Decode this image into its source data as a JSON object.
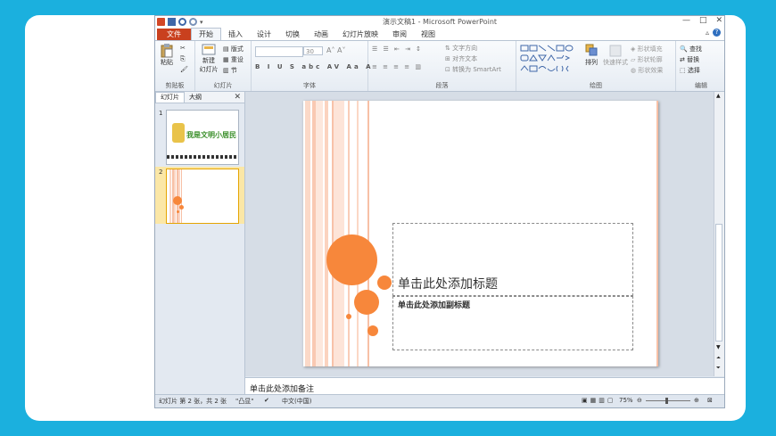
{
  "window": {
    "title": "演示文稿1 - Microsoft PowerPoint",
    "controls": [
      "—",
      "□",
      "✕"
    ]
  },
  "tabs": {
    "file": "文件",
    "items": [
      "开始",
      "插入",
      "设计",
      "切换",
      "动画",
      "幻灯片放映",
      "审阅",
      "视图"
    ],
    "active": "开始"
  },
  "ribbon": {
    "clipboard": {
      "label": "剪贴板",
      "paste": "粘贴"
    },
    "slides": {
      "label": "幻灯片",
      "new_slide": "新建",
      "new_slide2": "幻灯片",
      "layout": "版式",
      "reset": "重设",
      "section": "节"
    },
    "font": {
      "label": "字体",
      "size": "30"
    },
    "paragraph": {
      "label": "段落",
      "text_direction": "文字方向",
      "align_text": "对齐文本",
      "smartart": "转换为 SmartArt"
    },
    "drawing": {
      "label": "绘图",
      "arrange": "排列",
      "quick_styles": "快速样式",
      "shape_fill": "形状填充",
      "shape_outline": "形状轮廓",
      "shape_effects": "形状效果"
    },
    "editing": {
      "label": "编辑",
      "find": "查找",
      "replace": "替换",
      "select": "选择"
    }
  },
  "left_pane": {
    "tab_slides": "幻灯片",
    "tab_outline": "大纲",
    "close": "✕",
    "thumbnails": [
      {
        "number": "1",
        "title": "我是文明小居民"
      },
      {
        "number": "2"
      }
    ]
  },
  "slide": {
    "title_placeholder": "单击此处添加标题",
    "subtitle_placeholder": "单击此处添加副标题",
    "accent_color": "#f7873b",
    "stripe_color": "#f7c0a6"
  },
  "notes": {
    "placeholder": "单击此处添加备注"
  },
  "status": {
    "slide_info": "幻灯片 第 2 张，共 2 张",
    "theme": "\"凸显\"",
    "language": "中文(中国)",
    "zoom": "75%"
  },
  "colors": {
    "file_tab": "#c9401e",
    "background": "#1bb0de"
  }
}
